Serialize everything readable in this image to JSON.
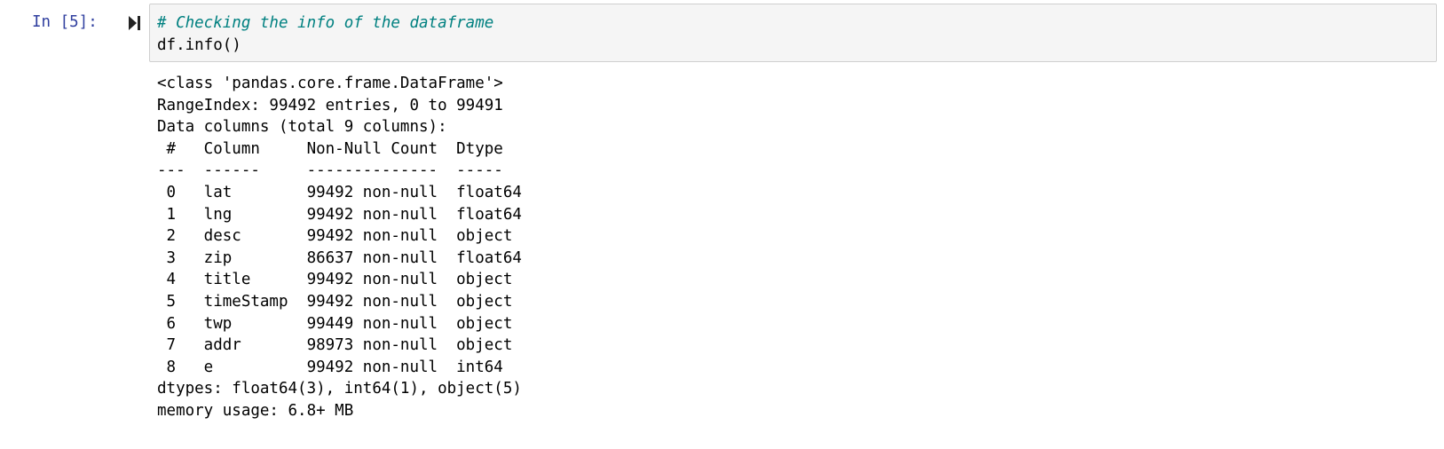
{
  "cell": {
    "prompt": "In [5]:",
    "run_icon": "run-cell-icon",
    "code": {
      "comment": "# Checking the info of the dataframe",
      "statement": "df.info()"
    },
    "output": {
      "lines": [
        "<class 'pandas.core.frame.DataFrame'>",
        "RangeIndex: 99492 entries, 0 to 99491",
        "Data columns (total 9 columns):",
        " #   Column     Non-Null Count  Dtype  ",
        "---  ------     --------------  -----  ",
        " 0   lat        99492 non-null  float64",
        " 1   lng        99492 non-null  float64",
        " 2   desc       99492 non-null  object ",
        " 3   zip        86637 non-null  float64",
        " 4   title      99492 non-null  object ",
        " 5   timeStamp  99492 non-null  object ",
        " 6   twp        99449 non-null  object ",
        " 7   addr       98973 non-null  object ",
        " 8   e          99492 non-null  int64  ",
        "dtypes: float64(3), int64(1), object(5)",
        "memory usage: 6.8+ MB"
      ]
    }
  },
  "colors": {
    "prompt": "#303f9f",
    "comment": "#008080",
    "input_background": "#f5f5f5",
    "input_border": "#cfcfcf"
  }
}
